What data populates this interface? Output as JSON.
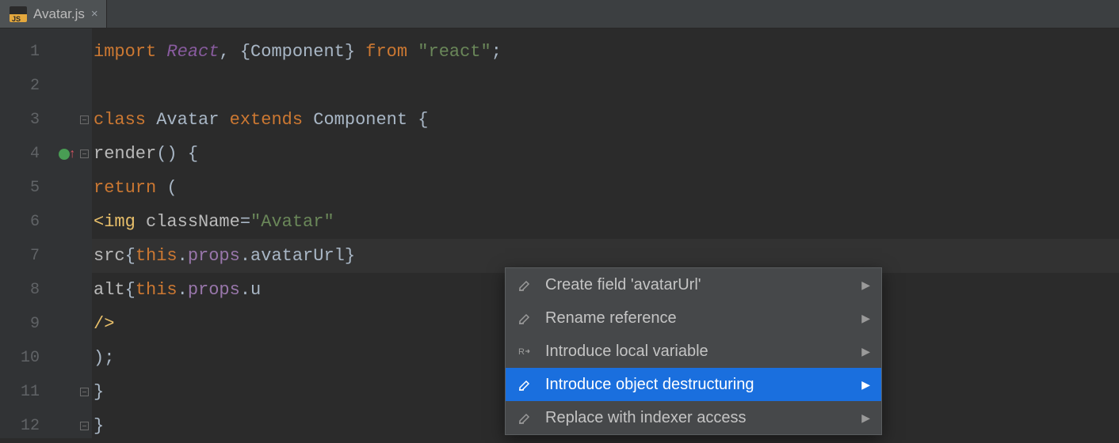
{
  "tab": {
    "filename": "Avatar.js"
  },
  "gutter_lines": [
    "1",
    "2",
    "3",
    "4",
    "5",
    "6",
    "7",
    "8",
    "9",
    "10",
    "11",
    "12"
  ],
  "code": {
    "l1": {
      "import": "import ",
      "react": "React",
      "comma": ", {",
      "comp": "Component",
      "close": "} ",
      "from": "from ",
      "str": "\"react\"",
      "semi": ";"
    },
    "l3": {
      "class": "class ",
      "name": "Avatar ",
      "extends": "extends ",
      "comp": "Component ",
      "brace": "{"
    },
    "l4": {
      "render": "render",
      "paren": "() {",
      "brace": ""
    },
    "l5": {
      "return": "return ",
      "paren": "("
    },
    "l6": {
      "open": "<",
      "img": "img ",
      "attrname": "className",
      "eq": "=",
      "val": "\"Avatar\""
    },
    "l7": {
      "attr": "src",
      "brace": "{",
      "this": "this",
      "dot1": ".",
      "props": "props",
      "dot2": ".",
      "field": "avatarUrl",
      "close": "}"
    },
    "l8": {
      "attr": "alt",
      "brace": "{",
      "this": "this",
      "dot1": ".",
      "props": "props",
      "dot2": ".",
      "field": "u"
    },
    "l9": {
      "selfclose": "/>"
    },
    "l10": {
      "paren": ");"
    },
    "l11": {
      "brace": "}"
    },
    "l12": {
      "brace": "}"
    }
  },
  "menu": {
    "items": [
      {
        "label": "Create field 'avatarUrl'",
        "icon": "pencil"
      },
      {
        "label": "Rename reference",
        "icon": "pencil"
      },
      {
        "label": "Introduce local variable",
        "icon": "r-arrow"
      },
      {
        "label": "Introduce object destructuring",
        "icon": "pencil"
      },
      {
        "label": "Replace with indexer access",
        "icon": "pencil"
      }
    ],
    "selected_index": 3
  }
}
